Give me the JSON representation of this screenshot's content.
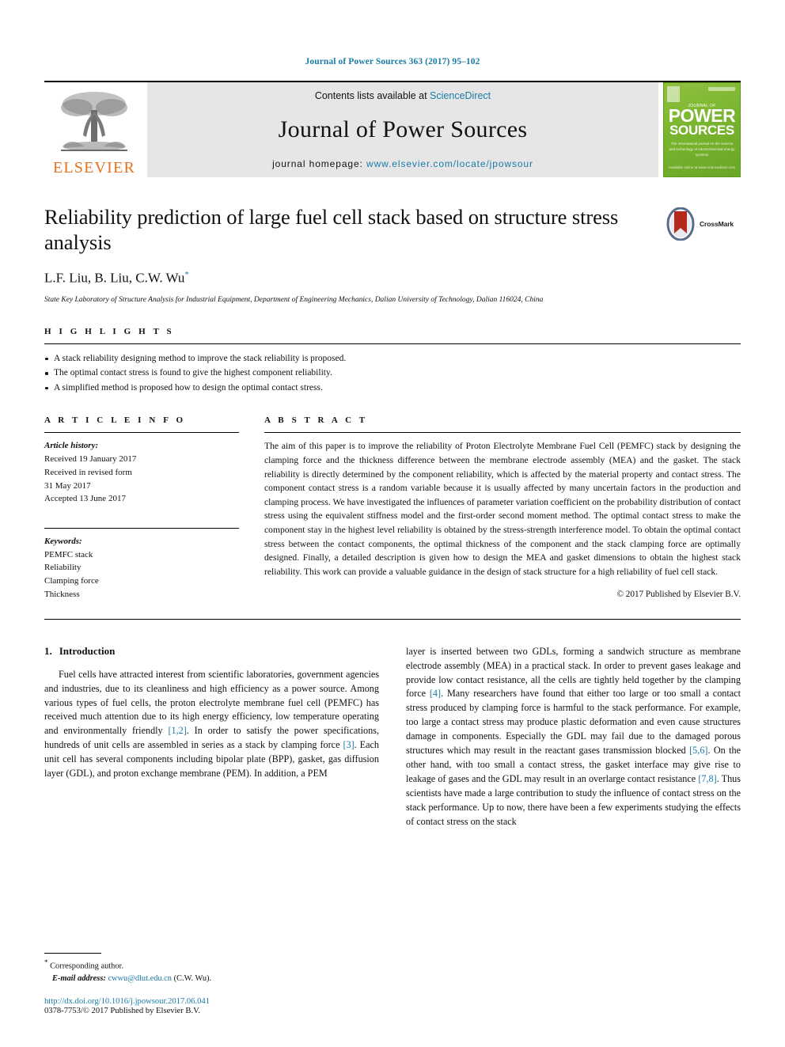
{
  "running_head": "Journal of Power Sources 363 (2017) 95–102",
  "masthead": {
    "publisher": "ELSEVIER",
    "contents_prefix": "Contents lists available at ",
    "contents_link": "ScienceDirect",
    "journal_name": "Journal of Power Sources",
    "homepage_prefix": "journal homepage: ",
    "homepage_url": "www.elsevier.com/locate/jpowsour",
    "cover": {
      "kicker": "JOURNAL OF",
      "title_line1": "POWER",
      "title_line2": "SOURCES",
      "subtitle": "The international journal on the science and technology of electrochemical energy systems",
      "bottom": "Available online at\nwww.sciencedirect.com"
    }
  },
  "article": {
    "title": "Reliability prediction of large fuel cell stack based on structure stress analysis",
    "authors": "L.F. Liu, B. Liu, C.W. Wu",
    "corresponding_marker": "*",
    "affiliation": "State Key Laboratory of Structure Analysis for Industrial Equipment, Department of Engineering Mechanics, Dalian University of Technology, Dalian 116024, China",
    "crossmark_label": "CrossMark"
  },
  "highlights": {
    "heading": "H I G H L I G H T S",
    "items": [
      "A stack reliability designing method to improve the stack reliability is proposed.",
      "The optimal contact stress is found to give the highest component reliability.",
      "A simplified method is proposed how to design the optimal contact stress."
    ]
  },
  "article_info": {
    "heading": "A R T I C L E   I N F O",
    "history_label": "Article history:",
    "history": [
      "Received 19 January 2017",
      "Received in revised form",
      "31 May 2017",
      "Accepted 13 June 2017"
    ],
    "keywords_label": "Keywords:",
    "keywords": [
      "PEMFC stack",
      "Reliability",
      "Clamping force",
      "Thickness"
    ]
  },
  "abstract": {
    "heading": "A B S T R A C T",
    "text": "The aim of this paper is to improve the reliability of Proton Electrolyte Membrane Fuel Cell (PEMFC) stack by designing the clamping force and the thickness difference between the membrane electrode assembly (MEA) and the gasket. The stack reliability is directly determined by the component reliability, which is affected by the material property and contact stress. The component contact stress is a random variable because it is usually affected by many uncertain factors in the production and clamping process. We have investigated the influences of parameter variation coefficient on the probability distribution of contact stress using the equivalent stiffness model and the first-order second moment method. The optimal contact stress to make the component stay in the highest level reliability is obtained by the stress-strength interference model. To obtain the optimal contact stress between the contact components, the optimal thickness of the component and the stack clamping force are optimally designed. Finally, a detailed description is given how to design the MEA and gasket dimensions to obtain the highest stack reliability. This work can provide a valuable guidance in the design of stack structure for a high reliability of fuel cell stack.",
    "copyright": "© 2017 Published by Elsevier B.V."
  },
  "body": {
    "section_number": "1.",
    "section_title": "Introduction",
    "left_paragraph_part1": "Fuel cells have attracted interest from scientific laboratories, government agencies and industries, due to its cleanliness and high efficiency as a power source. Among various types of fuel cells, the proton electrolyte membrane fuel cell (PEMFC) has received much attention due to its high energy efficiency, low temperature operating and environmentally friendly ",
    "ref_12": "[1,2]",
    "left_paragraph_part2": ". In order to satisfy the power specifications, hundreds of unit cells are assembled in series as a stack by clamping force ",
    "ref_3": "[3]",
    "left_paragraph_part3": ". Each unit cell has several components including bipolar plate (BPP), gasket, gas diffusion layer (GDL), and proton exchange membrane (PEM). In addition, a PEM",
    "right_part1": "layer is inserted between two GDLs, forming a sandwich structure as membrane electrode assembly (MEA) in a practical stack. In order to prevent gases leakage and provide low contact resistance, all the cells are tightly held together by the clamping force ",
    "ref_4": "[4]",
    "right_part2": ". Many researchers have found that either too large or too small a contact stress produced by clamping force is harmful to the stack performance. For example, too large a contact stress may produce plastic deformation and even cause structures damage in components. Especially the GDL may fail due to the damaged porous structures which may result in the reactant gases transmission blocked ",
    "ref_56": "[5,6]",
    "right_part3": ". On the other hand, with too small a contact stress, the gasket interface may give rise to leakage of gases and the GDL may result in an overlarge contact resistance ",
    "ref_78": "[7,8]",
    "right_part4": ". Thus scientists have made a large contribution to study the influence of contact stress on the stack performance. Up to now, there have been a few experiments studying the effects of contact stress on the stack"
  },
  "footer": {
    "corresponding_star": "*",
    "corresponding_label": "Corresponding author.",
    "email_label": "E-mail address: ",
    "email": "cwwu@dlut.edu.cn",
    "email_suffix": " (C.W. Wu).",
    "doi": "http://dx.doi.org/10.1016/j.jpowsour.2017.06.041",
    "issn": "0378-7753/© 2017 Published by Elsevier B.V."
  },
  "colors": {
    "link": "#1a7ba8",
    "elsevier_orange": "#e8711a",
    "cover_green": "#7ab52f"
  }
}
